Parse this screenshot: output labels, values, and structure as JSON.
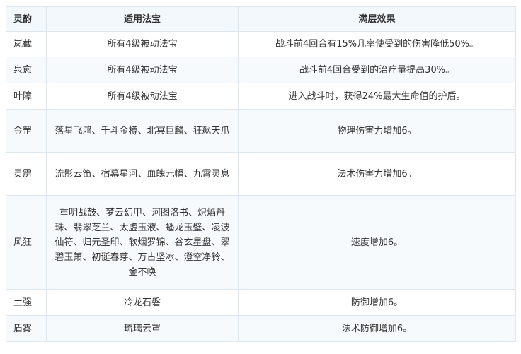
{
  "table": {
    "headers": [
      "灵韵",
      "适用法宝",
      "满层效果"
    ],
    "rows": [
      {
        "name": "岚截",
        "items": "所有4级被动法宝",
        "effect": "战斗前4回合有15%几率使受到的伤害降低50%。",
        "height": 36
      },
      {
        "name": "泉愈",
        "items": "所有4级被动法宝",
        "effect": "战斗前4回合受到的治疗量提高30%。",
        "height": 37
      },
      {
        "name": "叶障",
        "items": "所有4级被动法宝",
        "effect": "进入战斗时，获得24%最大生命值的护盾。",
        "height": 37
      },
      {
        "name": "金罡",
        "items": "落星飞鸿、千斗金樽、北冥巨麟、狂飙天爪",
        "effect": "物理伤害力增加6。",
        "height": 61
      },
      {
        "name": "灵雳",
        "items": "流影云笛、宿幕星河、血魄元幡、九霄灵息",
        "effect": "法术伤害力增加6。",
        "height": 61
      },
      {
        "name": "风狂",
        "items": "重明战鼓、梦云幻甲、河图洛书、炽焰丹珠、翡翠芝兰、太虚玉液、蟠龙玉璧、凌波仙符、归元圣印、软烟罗锦、谷玄星盘、翠碧玉箫、初诞春芽、万古坚冰、澄空净铃、金不唤",
        "effect": "速度增加6。",
        "height": 133
      },
      {
        "name": "土强",
        "items": "冷龙石磐",
        "effect": "防御增加6。",
        "height": 37
      },
      {
        "name": "盾雾",
        "items": "琉璃云罩",
        "effect": "法术防御增加6。",
        "height": 37
      }
    ]
  }
}
